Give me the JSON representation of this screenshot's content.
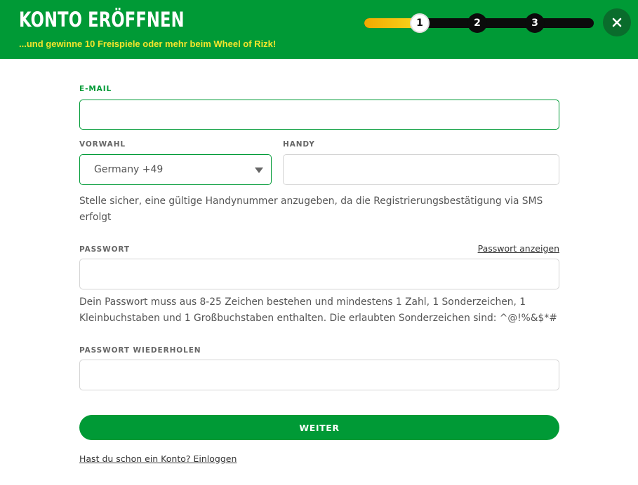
{
  "header": {
    "title": "KONTO ERÖFFNEN",
    "subtitle": "...und gewinne 10 Freispiele oder mehr beim Wheel of Rizk!",
    "background_color": "#009a36",
    "subtitle_color": "#f4e52c"
  },
  "steps": {
    "items": [
      "1",
      "2",
      "3"
    ],
    "current": 1,
    "progress_fraction": 0.22
  },
  "close": {
    "icon": "close-icon"
  },
  "form": {
    "email": {
      "label": "E-MAIL",
      "value": "",
      "placeholder": ""
    },
    "prefix": {
      "label": "VORWAHL",
      "selected": "Germany +49"
    },
    "phone": {
      "label": "HANDY",
      "value": "",
      "placeholder": ""
    },
    "phone_hint": "Stelle sicher, eine gültige Handynummer anzugeben, da die Registrierungsbestätigung via SMS erfolgt",
    "password": {
      "label": "PASSWORT",
      "show_label": "Passwort anzeigen",
      "value": "",
      "placeholder": ""
    },
    "password_hint": "Dein Passwort muss aus 8-25 Zeichen bestehen und mindestens 1 Zahl, 1 Sonderzeichen, 1 Kleinbuchstaben und 1 Großbuchstaben enthalten. Die erlaubten Sonderzeichen sind: ^@!%&$*#",
    "password_repeat": {
      "label": "PASSWORT WIEDERHOLEN",
      "value": "",
      "placeholder": ""
    },
    "submit_label": "WEITER",
    "login_link": "Hast du schon ein Konto? Einloggen"
  }
}
